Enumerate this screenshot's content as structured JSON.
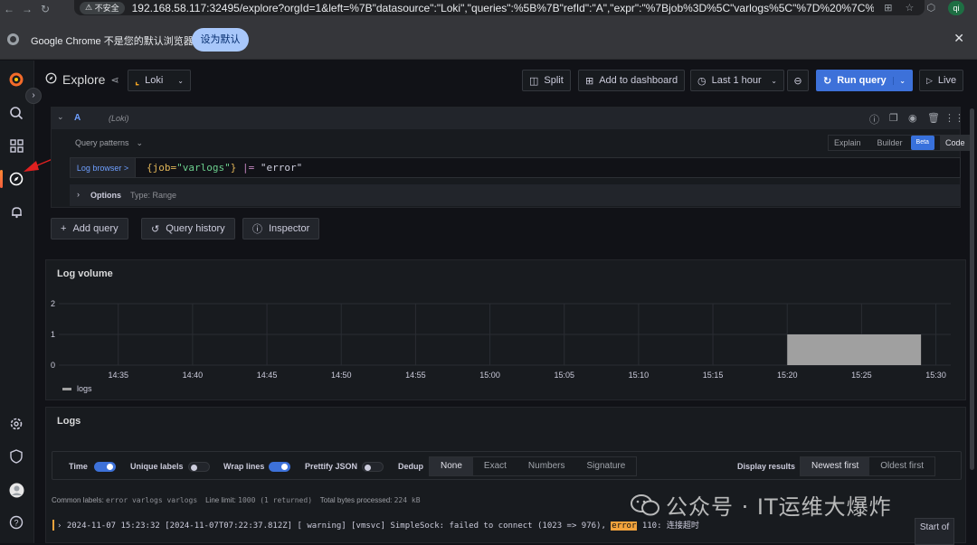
{
  "browser": {
    "not_secure": "不安全",
    "url": "192.168.58.117:32495/explore?orgId=1&left=%7B\"datasource\":\"Loki\",\"queries\":%5B%7B\"refId\":\"A\",\"expr\":\"%7Bjob%3D%5C\"varlogs%5C\"%7D%20%7C%3D%2...",
    "profile_initials": "qi",
    "infobar_message": "Google Chrome 不是您的默认浏览器",
    "set_default_label": "设为默认"
  },
  "toolbar": {
    "title": "Explore",
    "datasource": "Loki",
    "split_label": "Split",
    "add_to_dashboard_label": "Add to dashboard",
    "time_range_label": "Last 1 hour",
    "run_query_label": "Run query",
    "live_label": "Live"
  },
  "query": {
    "ref_id": "A",
    "datasource_tag": "(Loki)",
    "patterns_label": "Query patterns",
    "modes": [
      "Explain",
      "Builder",
      "Code"
    ],
    "beta_label": "Beta",
    "log_browser_label": "Log browser >",
    "code_selector_open": "{job=",
    "code_selector_value": "\"varlogs\"",
    "code_selector_close": "}",
    "code_pipe": "|=",
    "code_filter": "\"error\"",
    "options_label": "Options",
    "options_type": "Type: Range"
  },
  "actions": {
    "add_query": "Add query",
    "query_history": "Query history",
    "inspector": "Inspector"
  },
  "log_volume": {
    "title": "Log volume",
    "legend": "logs"
  },
  "chart_data": {
    "type": "bar",
    "title": "Log volume",
    "xlabel": "",
    "ylabel": "",
    "x_ticks": [
      "14:35",
      "14:40",
      "14:45",
      "14:50",
      "14:55",
      "15:00",
      "15:05",
      "15:10",
      "15:15",
      "15:20",
      "15:25",
      "15:30"
    ],
    "y_ticks": [
      0,
      1,
      2
    ],
    "ylim": [
      0,
      2
    ],
    "xlim": [
      "14:31",
      "15:31"
    ],
    "series": [
      {
        "name": "logs",
        "color": "#a0a0a0",
        "bars": [
          {
            "start": "15:20",
            "end": "15:29",
            "value": 1
          }
        ]
      }
    ],
    "grid": true,
    "legend": "bottom-left"
  },
  "logs": {
    "title": "Logs",
    "time_label": "Time",
    "unique_labels_label": "Unique labels",
    "wrap_lines_label": "Wrap lines",
    "prettify_json_label": "Prettify JSON",
    "dedup_label": "Dedup",
    "dedup_options": [
      "None",
      "Exact",
      "Numbers",
      "Signature"
    ],
    "display_results_label": "Display results",
    "order_options": [
      "Newest first",
      "Oldest first"
    ],
    "common_labels_label": "Common labels:",
    "common_labels_value": "error varlogs varlogs",
    "line_limit_label": "Line limit:",
    "line_limit_value": "1000 (1 returned)",
    "bytes_label": "Total bytes processed:",
    "bytes_value": "224 kB",
    "line_pre": "2024-11-07 15:23:32 [2024-11-07T07:22:37.812Z] [ warning] [vmsvc] SimpleSock: failed to connect (1023 => 976),",
    "line_highlight": "error",
    "line_post": "110: 连接超时",
    "start_label": "Start of"
  },
  "watermark": {
    "text": "公众号 · IT运维大爆炸"
  },
  "colors": {
    "accent": "#3d71d9",
    "background": "#111217",
    "panel": "#181b1f",
    "highlight": "#f2a33c"
  }
}
